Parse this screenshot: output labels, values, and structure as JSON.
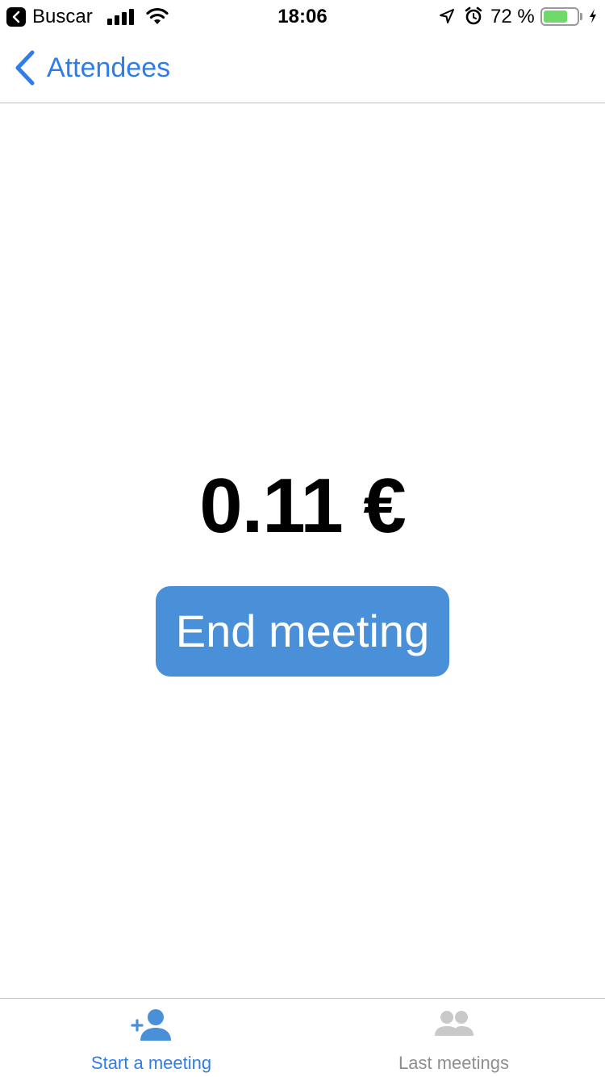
{
  "status_bar": {
    "back_app_label": "Buscar",
    "time": "18:06",
    "battery_percent_text": "72 %",
    "battery_level": 0.72,
    "icons": [
      "back-to-app-icon",
      "signal-icon",
      "wifi-icon",
      "location-icon",
      "alarm-icon",
      "battery-icon",
      "charging-icon"
    ]
  },
  "nav": {
    "back_label": "Attendees",
    "back_icon": "chevron-left-icon"
  },
  "main": {
    "cost": "0.11 €",
    "end_button_label": "End meeting"
  },
  "tabs": [
    {
      "label": "Start a meeting",
      "icon": "add-person-icon",
      "active": true
    },
    {
      "label": "Last meetings",
      "icon": "people-icon",
      "active": false
    }
  ],
  "colors": {
    "accent": "#2f7ee7",
    "button": "#4a90d9",
    "inactive": "#8e8e8e",
    "battery": "#6fd96a"
  }
}
